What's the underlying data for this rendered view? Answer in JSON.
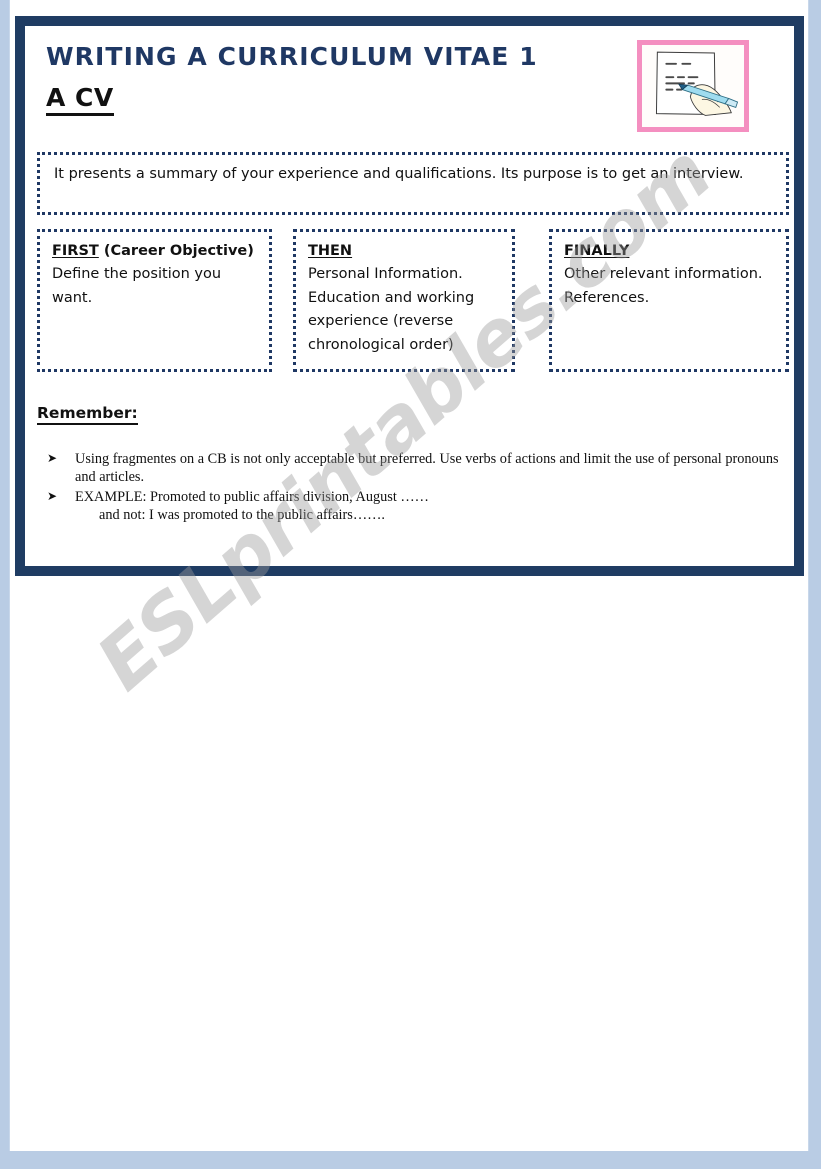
{
  "worksheet": {
    "title": "WRITING A CURRICULUM VITAE 1",
    "subtitle": "A CV",
    "clipart": {
      "name": "hand-writing-cv-illustration",
      "border_color": "#f48fc0"
    },
    "summary": {
      "text": "It presents a summary of your experience and qualifications. Its purpose is to get an interview."
    },
    "columns": [
      {
        "heading_underlined": "FIRST",
        "heading_rest": " (Career Objective)",
        "body": "Define the position you want."
      },
      {
        "heading_underlined": "THEN",
        "heading_rest": "",
        "body": "Personal Information. Education and working experience (reverse chronological order)"
      },
      {
        "heading_underlined": "FINALLY",
        "heading_rest": "",
        "body": "Other relevant information. References."
      }
    ],
    "remember": {
      "title": "Remember:",
      "bullet_glyph": "➤",
      "items": [
        {
          "line1": "Using fragmentes on a CB is not only acceptable but preferred. Use verbs of actions and limit the use of personal pronouns and articles.",
          "line2": ""
        },
        {
          "line1": "EXAMPLE: Promoted to public affairs division, August ……",
          "line2": "and not: I was promoted to the public affairs……."
        }
      ]
    },
    "colors": {
      "frame": "#1f3c63",
      "title": "#1f3864",
      "dotted_border": "#1f3864",
      "page_background": "#b9cce4",
      "clipart_border": "#f48fc0"
    }
  },
  "watermark": {
    "text": "ESLprintables.com"
  }
}
